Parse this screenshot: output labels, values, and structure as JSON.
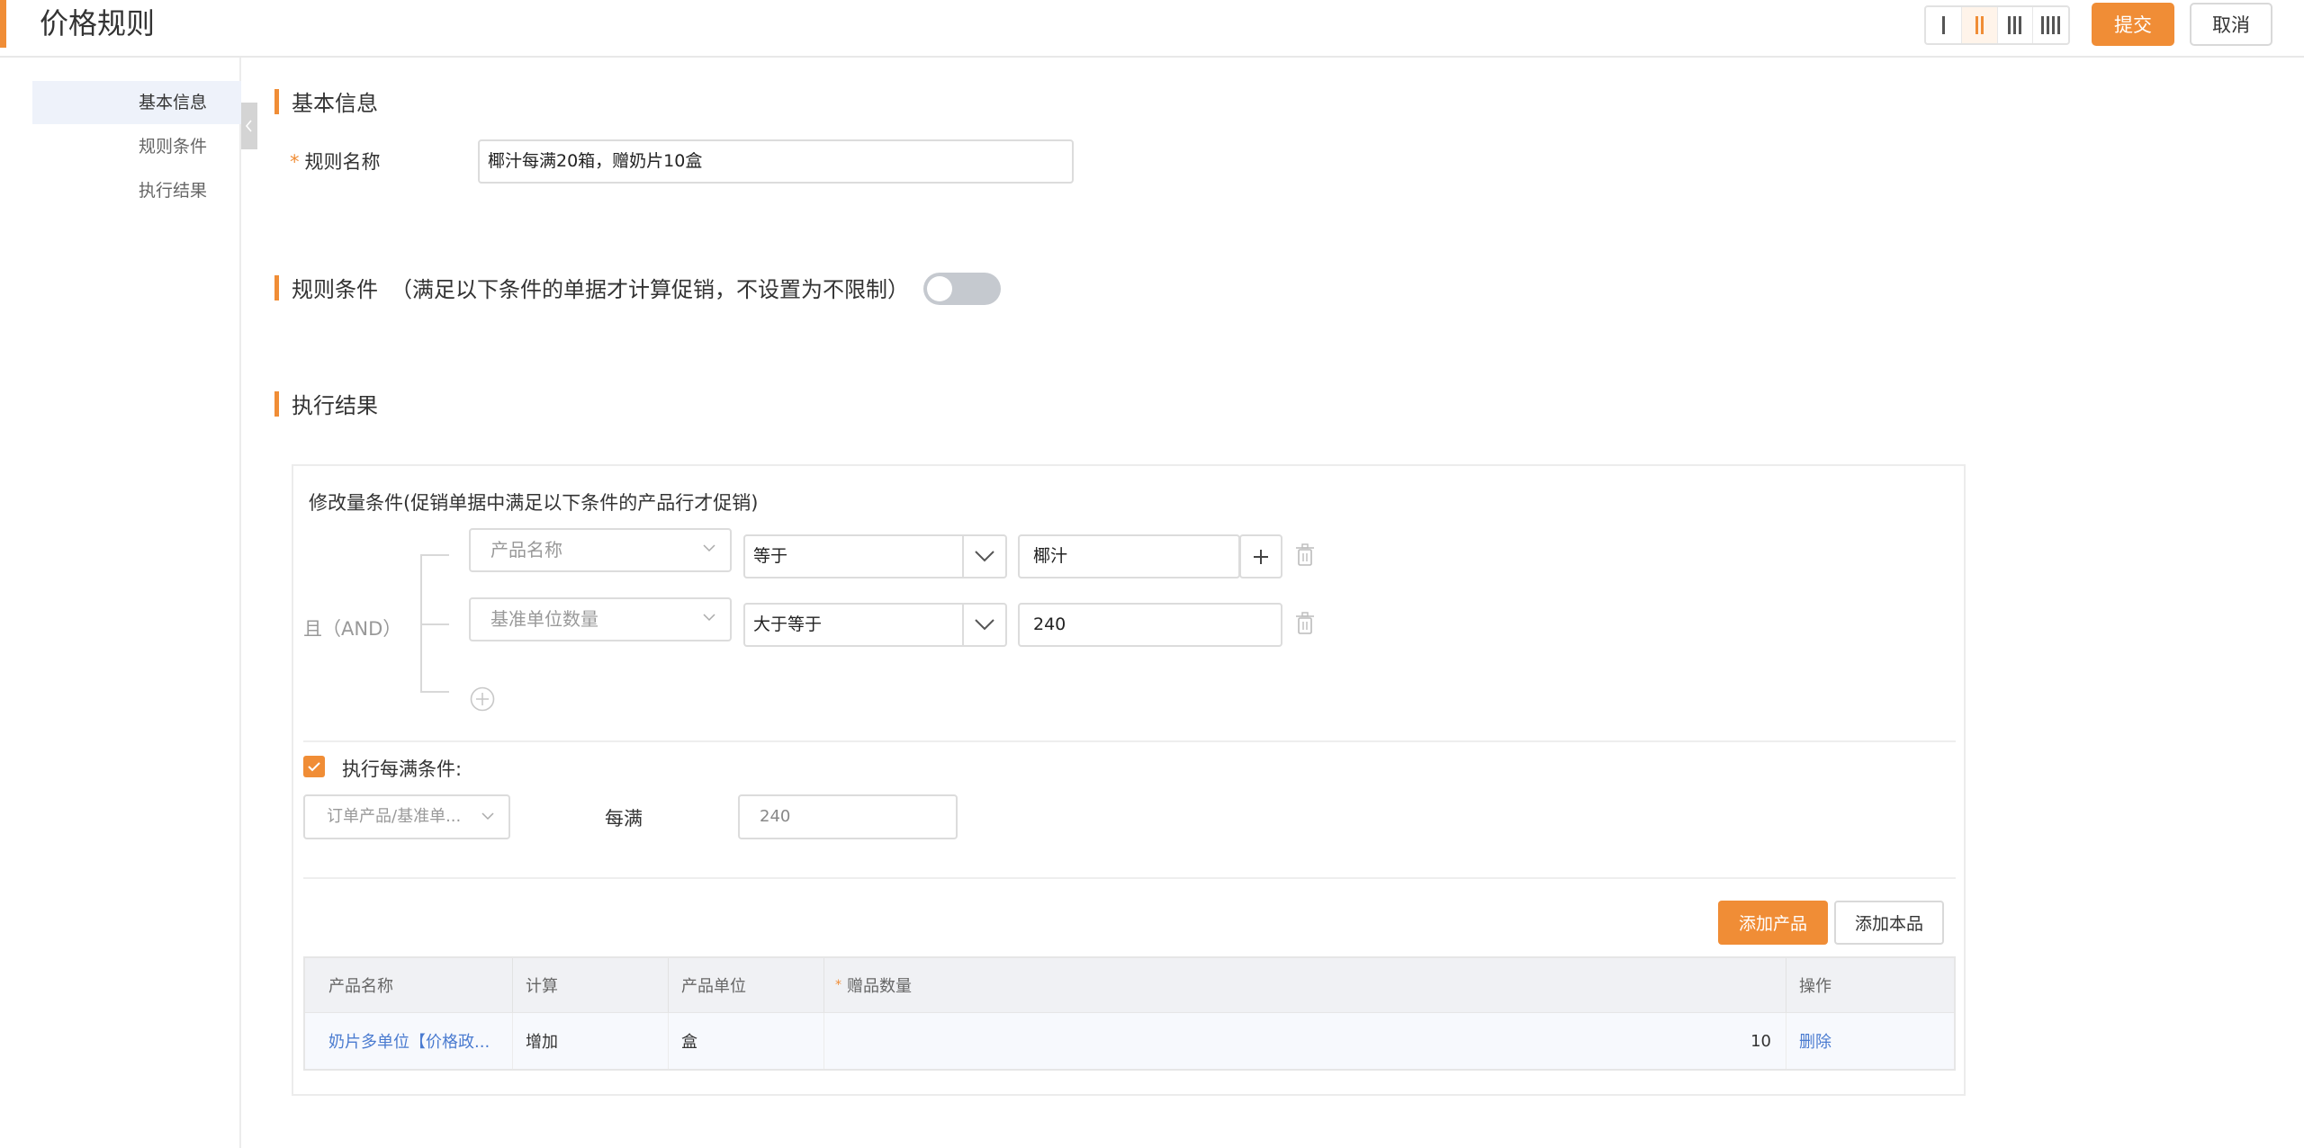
{
  "header": {
    "title": "价格规则",
    "column_modes": [
      "1-column",
      "2-column",
      "3-column",
      "4-column"
    ],
    "active_column_mode": 2,
    "submit_label": "提交",
    "cancel_label": "取消"
  },
  "sidebar": {
    "items": [
      {
        "label": "基本信息",
        "active": true
      },
      {
        "label": "规则条件",
        "active": false
      },
      {
        "label": "执行结果",
        "active": false
      }
    ]
  },
  "basic_info": {
    "section_title": "基本信息",
    "rule_name_label": "规则名称",
    "rule_name_value": "椰汁每满20箱，赠奶片10盒",
    "required_mark": "*"
  },
  "rule_conditions": {
    "section_title": "规则条件",
    "section_hint": "（满足以下条件的单据才计算促销，不设置为不限制）",
    "enabled": false
  },
  "execution_result": {
    "section_title": "执行结果",
    "condition_title": "修改量条件(促销单据中满足以下条件的产品行才促销)",
    "logic_label": "且（AND）",
    "conditions": [
      {
        "field": "产品名称",
        "operator": "等于",
        "value": "椰汁"
      },
      {
        "field": "基准单位数量",
        "operator": "大于等于",
        "value": "240"
      }
    ],
    "every_full": {
      "checked": true,
      "label": "执行每满条件:",
      "select_value": "订单产品/基准单...",
      "per_label": "每满",
      "per_value": "240"
    },
    "add_product_label": "添加产品",
    "add_self_label": "添加本品",
    "table": {
      "headers": [
        "产品名称",
        "计算",
        "产品单位",
        "赠品数量",
        "操作"
      ],
      "rows": [
        {
          "product": "奶片多单位【价格政...",
          "calc": "增加",
          "unit": "盒",
          "quantity": "10",
          "action": "删除"
        }
      ]
    }
  },
  "colors": {
    "accent": "#f08d36",
    "link": "#4a7bd0",
    "active_nav_bg": "#eef2fa"
  }
}
